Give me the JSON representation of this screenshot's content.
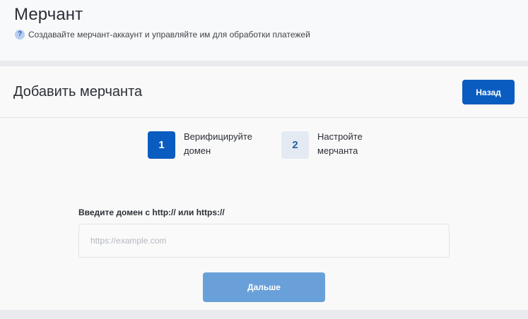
{
  "header": {
    "title": "Мерчант",
    "subtitle": "Создавайте мерчант-аккаунт и управляйте им для обработки платежей",
    "help_icon": "question-circle-icon"
  },
  "card": {
    "title": "Добавить мерчанта",
    "back_label": "Назад"
  },
  "steps": [
    {
      "number": "1",
      "line1": "Верифицируйте",
      "line2": "домен",
      "state": "active"
    },
    {
      "number": "2",
      "line1": "Настройте",
      "line2": "мерчанта",
      "state": "inactive"
    }
  ],
  "form": {
    "label": "Введите домен с http:// или https://",
    "value": "",
    "placeholder": "https://example.com",
    "next_label": "Дальше"
  },
  "colors": {
    "primary": "#0b5cc0",
    "primary_disabled": "#6aa0d9",
    "step_inactive_bg": "#e4eaf2"
  }
}
